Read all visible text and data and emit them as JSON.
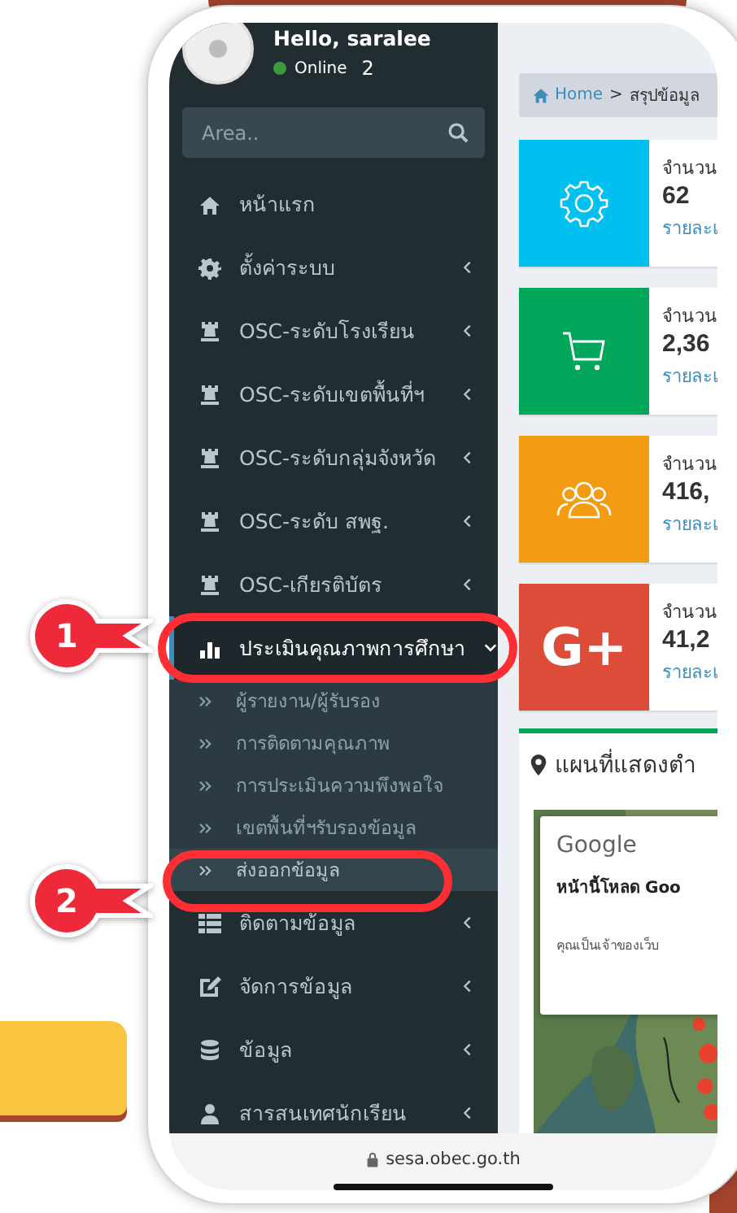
{
  "user": {
    "greeting": "Hello, saralee",
    "status": "Online",
    "online_count": "2"
  },
  "search": {
    "placeholder": "Area.."
  },
  "menu": [
    {
      "label": "หน้าแรก",
      "kind": "link",
      "selected": false
    },
    {
      "label": "ตั้งค่าระบบ",
      "kind": "tree",
      "expanded": false,
      "selected": false
    },
    {
      "label": "OSC-ระดับโรงเรียน",
      "kind": "tree",
      "expanded": false,
      "selected": false
    },
    {
      "label": "OSC-ระดับเขตพื้นที่ฯ",
      "kind": "tree",
      "expanded": false,
      "selected": false
    },
    {
      "label": "OSC-ระดับกลุ่มจังหวัด",
      "kind": "tree",
      "expanded": false,
      "selected": false
    },
    {
      "label": "OSC-ระดับ สพฐ.",
      "kind": "tree",
      "expanded": false,
      "selected": false
    },
    {
      "label": "OSC-เกียรติบัตร",
      "kind": "tree",
      "expanded": false,
      "selected": false
    },
    {
      "label": "ประเมินคุณภาพการศึกษา",
      "kind": "tree",
      "expanded": true,
      "selected": true,
      "children": [
        {
          "label": "ผู้รายงาน/ผู้รับรอง",
          "selected": false
        },
        {
          "label": "การติดตามคุณภาพ",
          "selected": false
        },
        {
          "label": "การประเมินความพึงพอใจ",
          "selected": false
        },
        {
          "label": "เขตพื้นที่ฯรับรองข้อมูล",
          "selected": false
        },
        {
          "label": "ส่งออกข้อมูล",
          "selected": true
        }
      ]
    },
    {
      "label": "ติดตามข้อมูล",
      "kind": "tree",
      "expanded": false,
      "selected": false
    },
    {
      "label": "จัดการข้อมูล",
      "kind": "tree",
      "expanded": false,
      "selected": false
    },
    {
      "label": "ข้อมูล",
      "kind": "tree",
      "expanded": false,
      "selected": false
    },
    {
      "label": "สารสนเทศนักเรียน",
      "kind": "tree",
      "expanded": false,
      "selected": false
    }
  ],
  "breadcrumb": {
    "home": "Home",
    "separator": ">",
    "current": "สรุปข้อมูล"
  },
  "info_boxes": [
    {
      "kind": "gear",
      "color": "#00c0ef",
      "label": "จำนวน",
      "value": "62",
      "link": "รายละเ"
    },
    {
      "kind": "cart",
      "color": "#00a65a",
      "label": "จำนวน",
      "value": "2,36",
      "link": "รายละเ"
    },
    {
      "kind": "users",
      "color": "#f39c12",
      "label": "จำนวน",
      "value": "416,",
      "link": "รายละเ"
    },
    {
      "kind": "logo",
      "logo": "G+",
      "color": "#dd4b39",
      "label": "จำนวน",
      "value": "41,2",
      "link": "รายละเ"
    }
  ],
  "map_card": {
    "title": "แผนที่แสดงตำ",
    "dialog": {
      "brand": "Google",
      "heading": "หน้านี้โหลด Goo",
      "body": "คุณเป็นเจ้าของเว็บ"
    }
  },
  "url_bar": {
    "url": "sesa.obec.go.th"
  },
  "callouts": [
    {
      "number": "1"
    },
    {
      "number": "2"
    }
  ]
}
